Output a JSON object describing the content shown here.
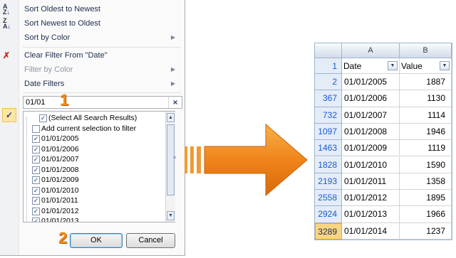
{
  "menu": {
    "sort_asc": "Sort Oldest to Newest",
    "sort_desc": "Sort Newest to Oldest",
    "sort_color": "Sort by Color",
    "clear_filter": "Clear Filter From \"Date\"",
    "filter_color": "Filter by Color",
    "date_filters": "Date Filters",
    "search_value": "01/01",
    "step1": "1",
    "step2": "2",
    "ok_label": "OK",
    "cancel_label": "Cancel",
    "checklist": [
      "(Select All Search Results)",
      "Add current selection to filter",
      "01/01/2005",
      "01/01/2006",
      "01/01/2007",
      "01/01/2008",
      "01/01/2009",
      "01/01/2010",
      "01/01/2011",
      "01/01/2012",
      "01/01/2013"
    ]
  },
  "sheet": {
    "col_a": "A",
    "col_b": "B",
    "header_row": "1",
    "date_header": "Date",
    "value_header": "Value",
    "rows": [
      {
        "row": "2",
        "date": "01/01/2005",
        "value": "1887"
      },
      {
        "row": "367",
        "date": "01/01/2006",
        "value": "1130"
      },
      {
        "row": "732",
        "date": "01/01/2007",
        "value": "1114"
      },
      {
        "row": "1097",
        "date": "01/01/2008",
        "value": "1946"
      },
      {
        "row": "1463",
        "date": "01/01/2009",
        "value": "1119"
      },
      {
        "row": "1828",
        "date": "01/01/2010",
        "value": "1590"
      },
      {
        "row": "2193",
        "date": "01/01/2011",
        "value": "1358"
      },
      {
        "row": "2558",
        "date": "01/01/2012",
        "value": "1895"
      },
      {
        "row": "2924",
        "date": "01/01/2013",
        "value": "1966"
      },
      {
        "row": "3289",
        "date": "01/01/2014",
        "value": "1237"
      }
    ]
  },
  "colors": {
    "accent_orange": "#f08a1c",
    "row_number_blue": "#1a5ad6"
  }
}
